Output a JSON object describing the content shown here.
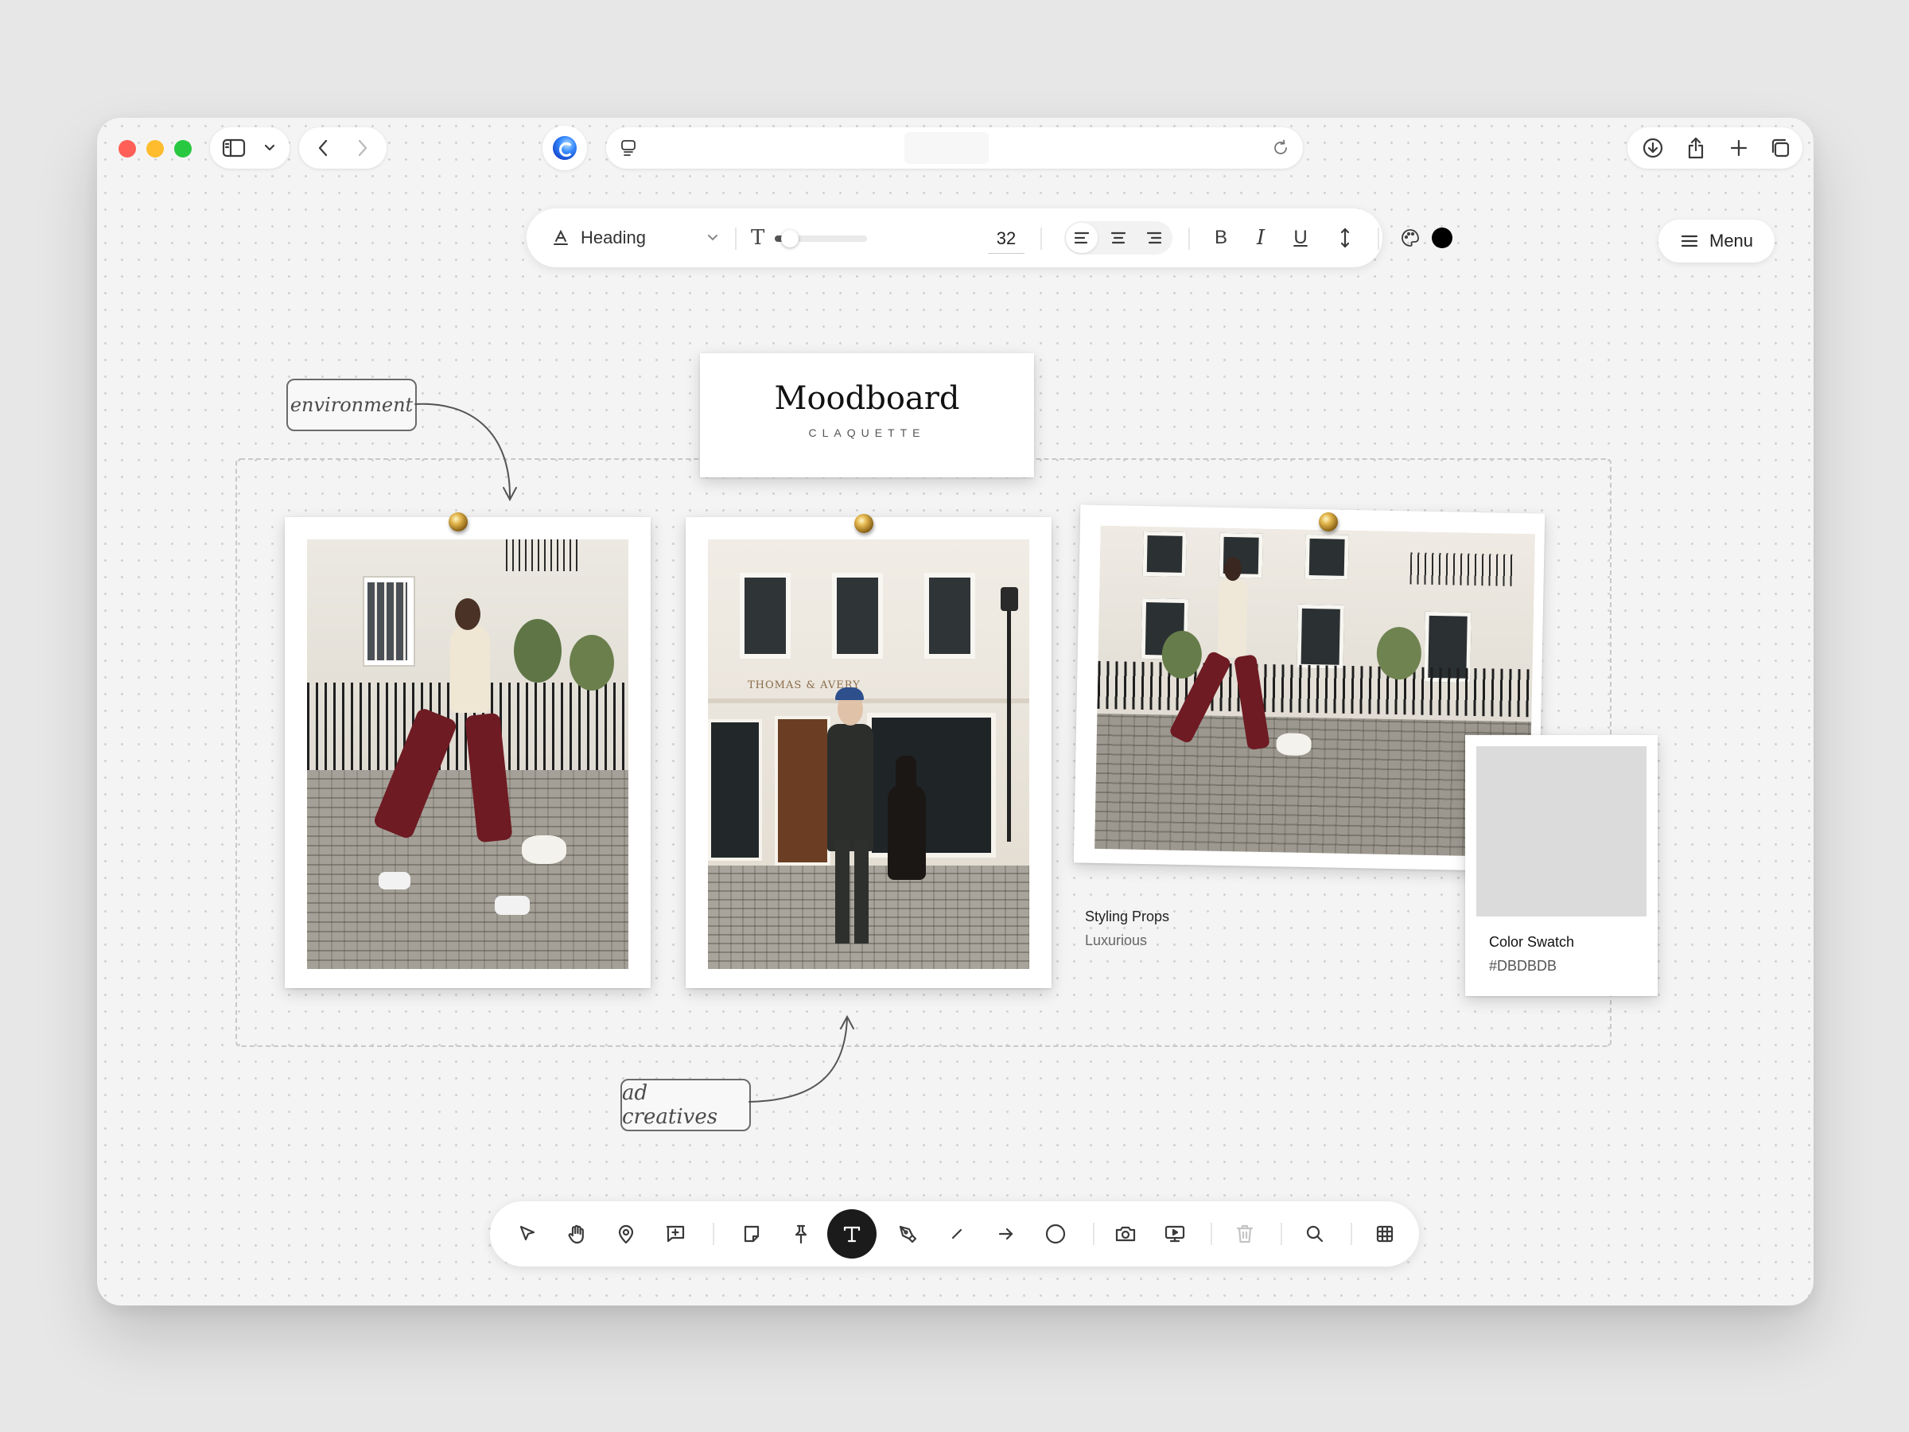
{
  "toolbar": {
    "text_style": "Heading",
    "font_size": "32",
    "font_size_fraction": 0.12,
    "text_color": "#000000"
  },
  "menu": {
    "label": "Menu"
  },
  "board": {
    "title": "Moodboard",
    "subtitle": "CLAQUETTE",
    "tag_environment": "environment",
    "tag_ad_creatives": "ad creatives",
    "photo2_sign": "THOMAS & AVERY",
    "styling_props": {
      "label": "Styling Props",
      "value": "Luxurious"
    },
    "color_swatch": {
      "label": "Color Swatch",
      "value": "#DBDBDB",
      "color": "#dbdbdb"
    }
  },
  "bottom_tools": [
    "select-icon",
    "hand-icon",
    "location-pin-icon",
    "add-comment-icon",
    "note-icon",
    "pushpin-icon",
    "text-tool-icon",
    "pen-icon",
    "line-icon",
    "arrow-icon",
    "circle-icon",
    "camera-icon",
    "present-icon",
    "trash-icon",
    "search-icon",
    "grid-icon"
  ],
  "colors": {
    "traffic_red": "#ff5f57",
    "traffic_yellow": "#febc2e",
    "traffic_green": "#28c840",
    "burgundy": "#6e1b23"
  }
}
